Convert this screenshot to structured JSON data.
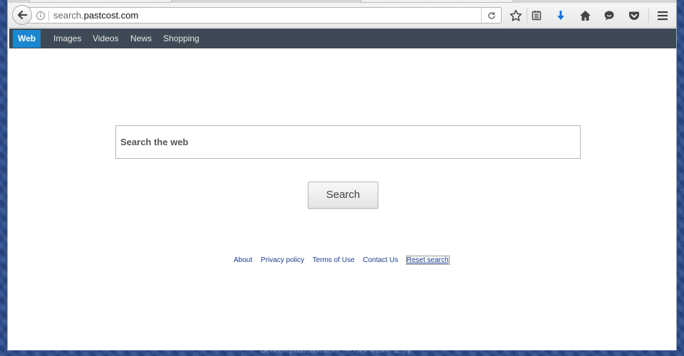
{
  "browser": {
    "url_prefix": "search.",
    "url_domain": "pastcost.com",
    "icons": {
      "back": "back-arrow-icon",
      "info": "info-icon",
      "reload": "reload-icon",
      "bookmark": "star-icon",
      "reading_list": "reading-list-icon",
      "download": "download-arrow-icon",
      "home": "home-icon",
      "chat": "chat-bubble-icon",
      "pocket": "pocket-icon",
      "menu": "hamburger-menu-icon"
    },
    "download_icon_color": "#1a73d9"
  },
  "nav": {
    "items": [
      {
        "label": "Web",
        "active": true
      },
      {
        "label": "Images",
        "active": false
      },
      {
        "label": "Videos",
        "active": false
      },
      {
        "label": "News",
        "active": false
      },
      {
        "label": "Shopping",
        "active": false
      }
    ],
    "bar_color": "#3d4a55",
    "active_color": "#1a87d0"
  },
  "search": {
    "placeholder": "Search the web",
    "button_label": "Search"
  },
  "footer": {
    "links": [
      "About",
      "Privacy policy",
      "Terms of Use",
      "Contact Us",
      "Reset search"
    ]
  },
  "caption": "Search.pastcost.com — СПАЙВАРЕ.ру"
}
